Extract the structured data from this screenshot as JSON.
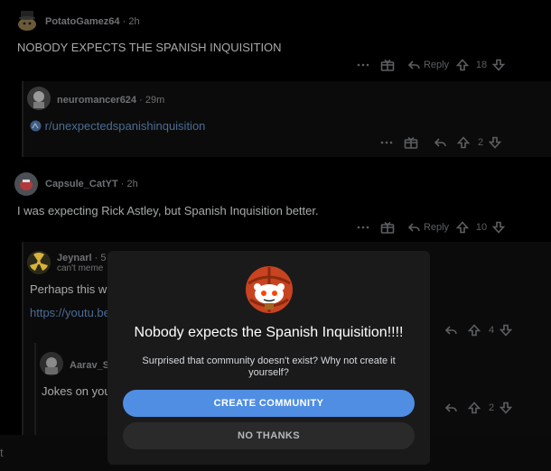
{
  "comments": [
    {
      "username": "PotatoGamez64",
      "time": "2h",
      "text": "NOBODY EXPECTS THE SPANISH INQUISITION",
      "votes": "18",
      "reply_label": "Reply"
    },
    {
      "username": "neuromancer624",
      "time": "29m",
      "link_text": "r/unexpectedspanishinquisition",
      "votes": "2"
    },
    {
      "username": "Capsule_CatYT",
      "time": "2h",
      "text": "I was expecting Rick Astley, but Spanish Inquisition better.",
      "votes": "10",
      "reply_label": "Reply"
    },
    {
      "username": "Jeynarl",
      "time": "5",
      "flair": "can't meme",
      "text": "Perhaps this wi",
      "link_text": "https://youtu.be",
      "votes": "4"
    },
    {
      "username": "Aarav_S",
      "text": "Jokes on you",
      "votes": "2"
    }
  ],
  "bottom_bar": {
    "placeholder": "t"
  },
  "modal": {
    "title": "Nobody expects the Spanish Inquisition!!!!",
    "subtitle": "Surprised that community doesn't exist? Why not create it yourself?",
    "create_label": "CREATE COMMUNITY",
    "dismiss_label": "NO THANKS"
  },
  "colors": {
    "primary_button": "#4f8ee3",
    "modal_bg": "#1a1a1b",
    "page_bg": "#000000"
  },
  "icons": [
    "more-icon",
    "award-icon",
    "reply-icon",
    "upvote-icon",
    "downvote-icon",
    "community-icon"
  ]
}
